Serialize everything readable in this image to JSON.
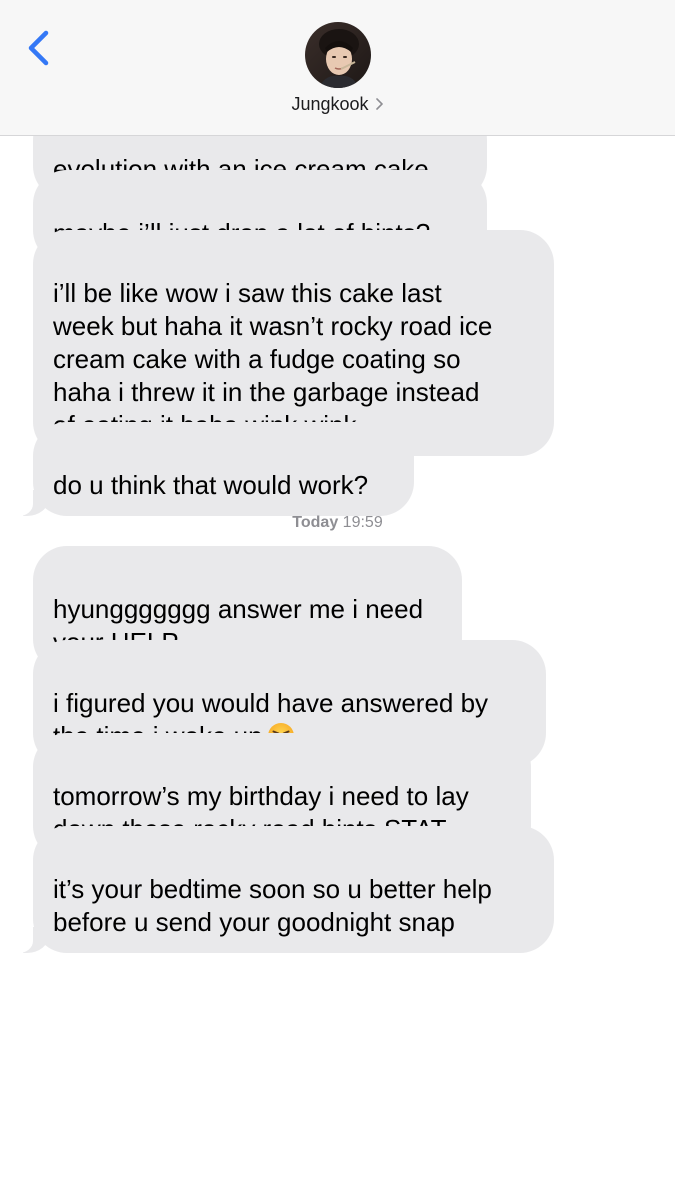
{
  "header": {
    "contact_name": "Jungkook",
    "back_icon": "chevron-left-icon",
    "disclosure_icon": "chevron-right-icon",
    "accent_color": "#3478f6"
  },
  "thread": {
    "bubble_color": "#e9e9eb",
    "timestamp": {
      "day": "Today",
      "time": "19:59"
    },
    "messages": [
      {
        "text": "evolution with an ice cream cake"
      },
      {
        "text": "maybe i’ll just drop a lot of hints?"
      },
      {
        "text": "i’ll be like wow i saw this cake last\nweek but haha it wasn’t rocky road ice\ncream cake with a fudge coating so\nhaha i threw it in the garbage instead\nof eating it haha wink wink"
      },
      {
        "text": "do u think that would work?"
      },
      {
        "text": "hyunggggggg answer me i need\nyour HELP"
      },
      {
        "text": "i figured you would have answered by\nthe time i woke up",
        "emoji": "angry-face-emoji"
      },
      {
        "text": "tomorrow’s my birthday i need to lay\ndown these rocky road hints STAT"
      },
      {
        "text": "it’s your bedtime soon so u better help\nbefore u send your goodnight snap"
      }
    ]
  }
}
